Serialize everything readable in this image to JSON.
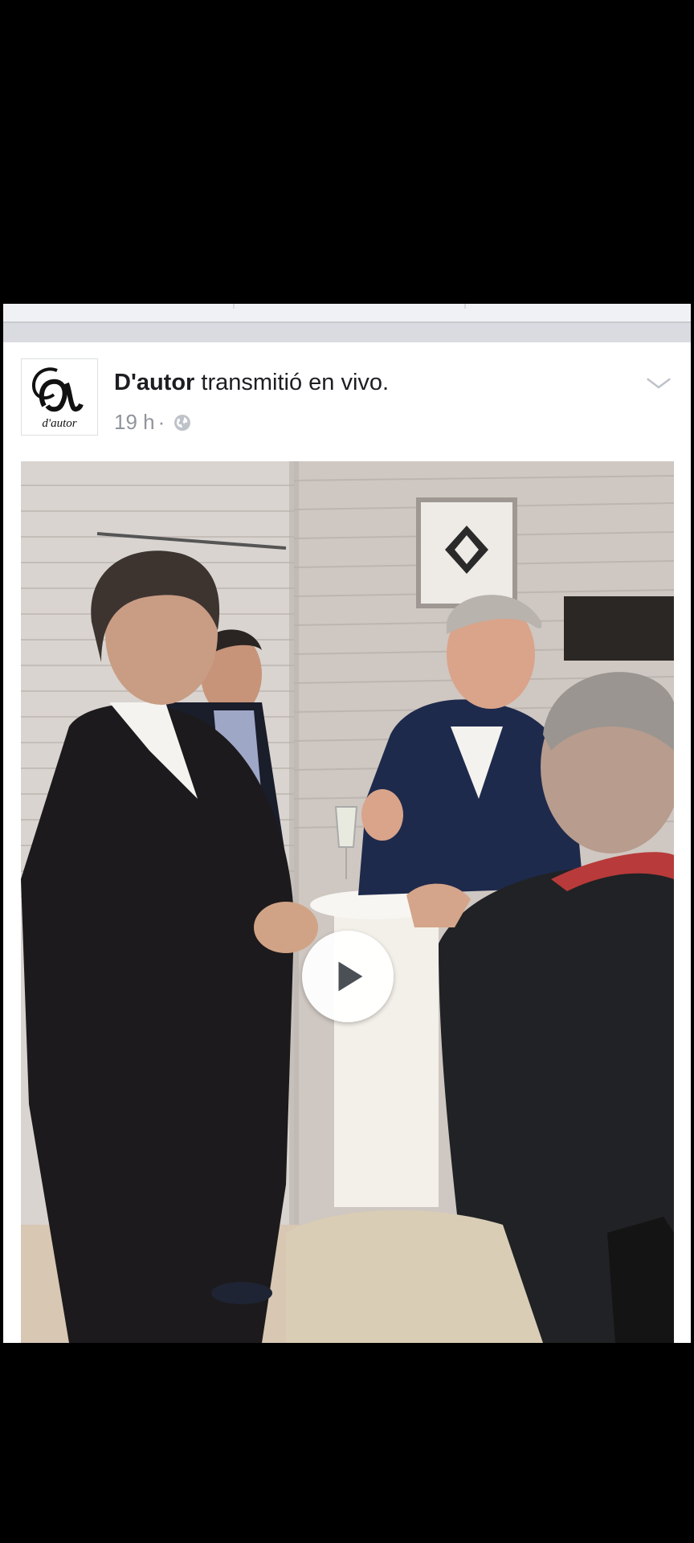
{
  "post": {
    "page_name": "D'autor",
    "action": " transmitió en vivo.",
    "timestamp": "19 h",
    "separator": " ·",
    "avatar_text": "d'autor",
    "privacy_icon": "globe-icon",
    "menu_icon": "chevron-down-icon"
  },
  "video": {
    "play_icon": "play-icon"
  },
  "colors": {
    "background": "#000000",
    "card": "#ffffff",
    "meta_text": "#90949c",
    "name_text": "#1c1e21"
  }
}
